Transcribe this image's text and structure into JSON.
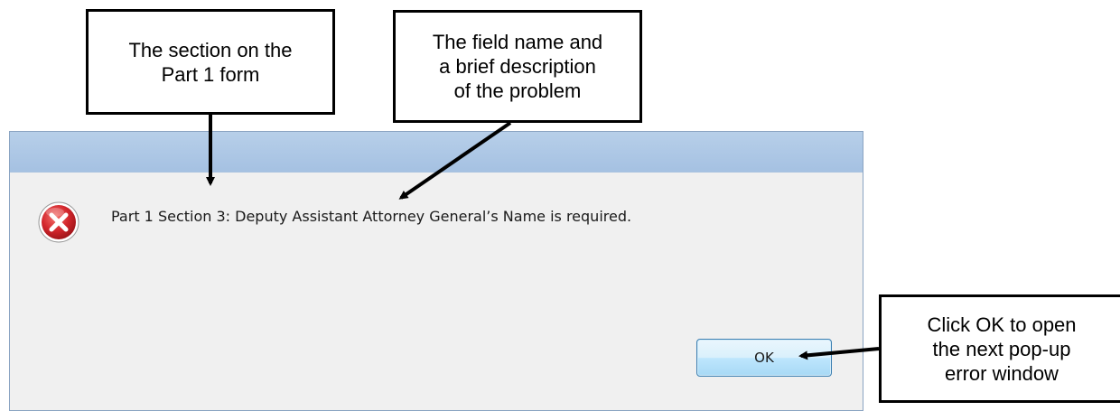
{
  "dialog": {
    "message": "Part 1 Section 3: Deputy Assistant Attorney General’s Name is required.",
    "ok_label": "OK",
    "icon": "error-icon"
  },
  "callouts": {
    "section": "The section on the\nPart 1 form",
    "field": "The field name and\na brief description\nof the problem",
    "ok": "Click OK to open\nthe next pop-up\nerror window"
  },
  "colors": {
    "titlebar": "#a9c4e4",
    "dialog_bg": "#f0f0f0",
    "error_red": "#c8202b",
    "ok_border": "#3c7fb1"
  }
}
